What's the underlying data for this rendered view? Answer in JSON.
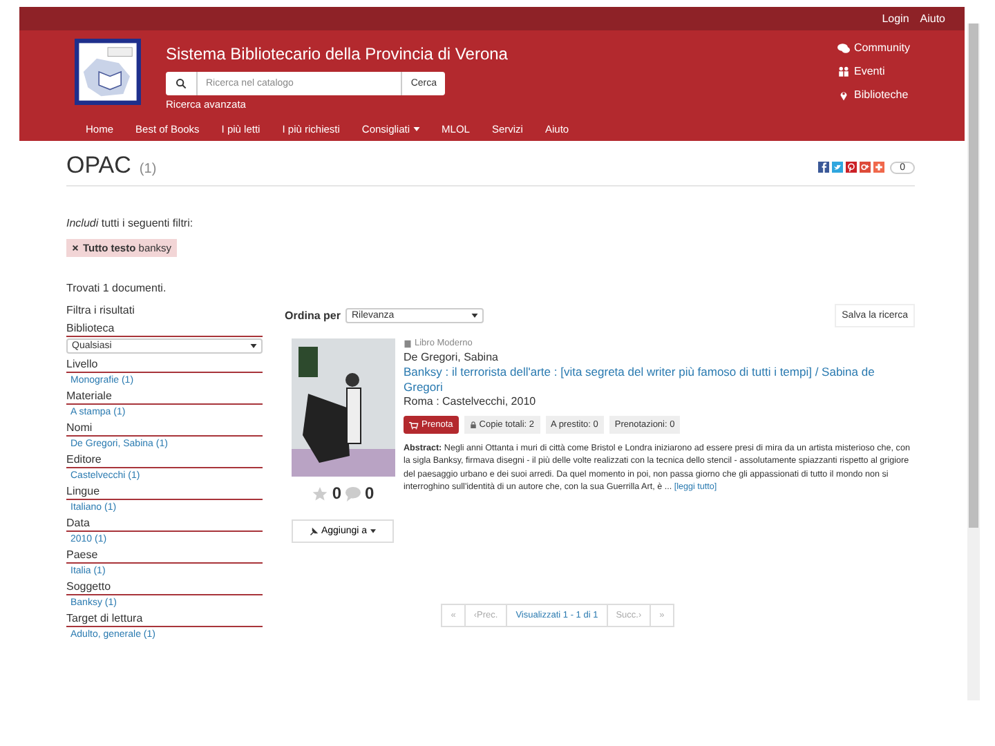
{
  "topbar": {
    "links": [
      "Login",
      "Aiuto"
    ]
  },
  "header": {
    "title": "Sistema Bibliotecario della Provincia di Verona",
    "search": {
      "placeholder": "Ricerca nel catalogo",
      "button": "Cerca"
    },
    "advanced_link": "Ricerca avanzata",
    "side_links": [
      {
        "kind": "chat",
        "label": "Community"
      },
      {
        "kind": "people",
        "label": "Eventi"
      },
      {
        "kind": "pin",
        "label": "Biblioteche"
      }
    ]
  },
  "nav": [
    {
      "label": "Home",
      "dropdown": false
    },
    {
      "label": "Best of Books",
      "dropdown": false
    },
    {
      "label": "I più letti",
      "dropdown": false
    },
    {
      "label": "I più richiesti",
      "dropdown": false
    },
    {
      "label": "Consigliati",
      "dropdown": true
    },
    {
      "label": "MLOL",
      "dropdown": false
    },
    {
      "label": "Servizi",
      "dropdown": false
    },
    {
      "label": "Aiuto",
      "dropdown": false
    }
  ],
  "page": {
    "title": "OPAC",
    "count": "(1)",
    "share_count": "0"
  },
  "filters": {
    "intro": "*Includi* tutti i seguenti filtri:",
    "tags": [
      {
        "field": "Tutto testo",
        "value": "banksy"
      }
    ]
  },
  "found": "Trovati 1 documenti.",
  "facets_title": "Filtra i risultati",
  "facets": [
    {
      "name": "Biblioteca",
      "kind": "select",
      "value": "Qualsiasi"
    },
    {
      "name": "Livello",
      "kind": "link",
      "value": "Monografie (1)"
    },
    {
      "name": "Materiale",
      "kind": "link",
      "value": "A stampa (1)"
    },
    {
      "name": "Nomi",
      "kind": "link",
      "value": "De Gregori, Sabina (1)"
    },
    {
      "name": "Editore",
      "kind": "link",
      "value": "Castelvecchi (1)"
    },
    {
      "name": "Lingue",
      "kind": "link",
      "value": "Italiano (1)"
    },
    {
      "name": "Data",
      "kind": "link",
      "value": "2010 (1)"
    },
    {
      "name": "Paese",
      "kind": "link",
      "value": "Italia (1)"
    },
    {
      "name": "Soggetto",
      "kind": "link",
      "value": "Banksy (1)"
    },
    {
      "name": "Target di lettura",
      "kind": "link",
      "value": "Adulto, generale (1)"
    }
  ],
  "sort": {
    "label": "Ordina per",
    "value": "Rilevanza"
  },
  "save_search": "Salva la ricerca",
  "results": [
    {
      "type": "Libro Moderno",
      "author": "De Gregori, Sabina",
      "title": "Banksy : il terrorista dell'arte : [vita segreta del writer più famoso di tutti i tempi] / Sabina de Gregori",
      "publication": "Roma : Castelvecchi, 2010",
      "reserve": "Prenota",
      "copies": "Copie totali: 2",
      "on_loan": "A prestito: 0",
      "reservations": "Prenotazioni: 0",
      "abstract": "**Abstract:** Negli anni Ottanta i muri di città come Bristol e Londra iniziarono ad essere presi di mira da un artista misterioso che, con la sigla Banksy, firmava disegni - il più delle volte realizzati con la tecnica dello stencil - assolutamente spiazzanti rispetto al grigiore del paesaggio urbano e dei suoi arredi. Da quel momento in poi, non passa giorno che gli appassionati di tutto il mondo non si interroghino sull'identità di un autore che, con la sua Guerrilla Art, è ...",
      "read_more": "[leggi tutto]",
      "rating": "0",
      "comments": "0",
      "add": "Aggiungi a"
    }
  ],
  "pagination": [
    {
      "label": "«",
      "selected": false
    },
    {
      "label": "‹Prec.",
      "selected": false
    },
    {
      "label": "Visualizzati 1 - 1 di 1",
      "selected": true
    },
    {
      "label": "Succ.›",
      "selected": false
    },
    {
      "label": "»",
      "selected": false
    }
  ]
}
